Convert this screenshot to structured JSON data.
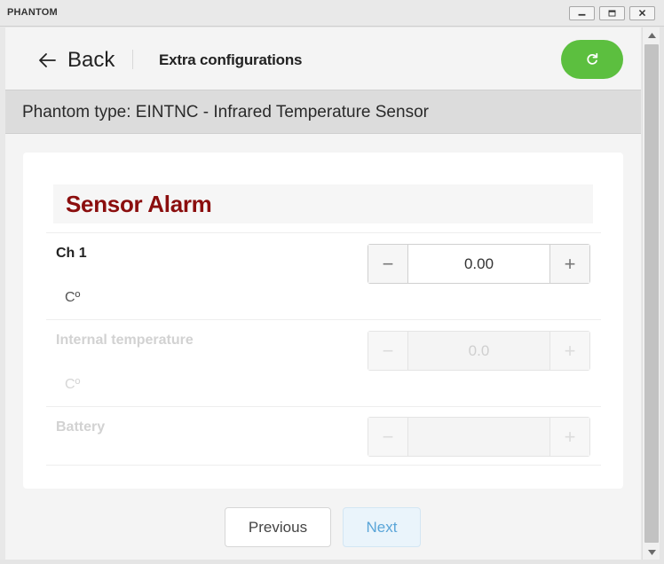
{
  "window": {
    "title": "PHANTOM",
    "controls": [
      "minimize-icon",
      "maximize-icon",
      "close-icon"
    ]
  },
  "header": {
    "back_label": "Back",
    "title": "Extra configurations",
    "refresh_icon": "refresh-icon"
  },
  "phantom_type": "Phantom type: EINTNC - Infrared Temperature Sensor",
  "section": {
    "title": "Sensor Alarm",
    "rows": [
      {
        "label": "Ch 1",
        "unit": "Cº",
        "value": "0.00",
        "enabled": true
      },
      {
        "label": "Internal temperature",
        "unit": "Cº",
        "value": "0.0",
        "enabled": false
      },
      {
        "label": "Battery",
        "unit": "",
        "value": "",
        "enabled": false
      }
    ]
  },
  "stepper_symbols": {
    "decrement": "−",
    "increment": "+"
  },
  "footer": {
    "previous_label": "Previous",
    "next_label": "Next"
  },
  "colors": {
    "accent_green": "#5cbf3f",
    "section_title": "#8b0e0e",
    "next_button_text": "#5aa5d8"
  }
}
